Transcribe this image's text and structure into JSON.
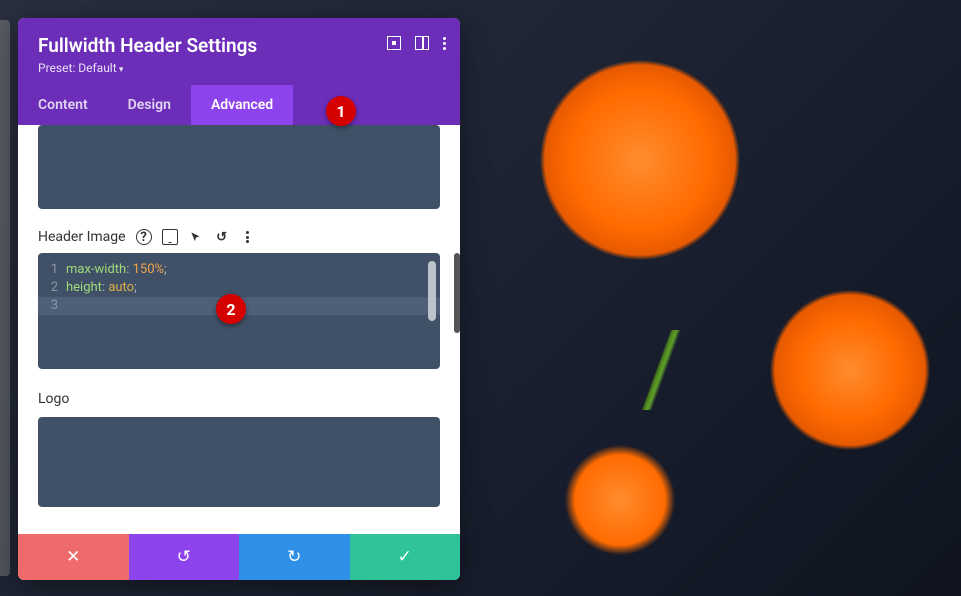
{
  "panel": {
    "title": "Fullwidth Header Settings",
    "preset": "Preset: Default"
  },
  "tabs": {
    "content": "Content",
    "design": "Design",
    "advanced": "Advanced"
  },
  "sections": {
    "header_image_label": "Header Image",
    "logo_label": "Logo"
  },
  "editor": {
    "lines": [
      {
        "n": "1",
        "prop": "max-width",
        "val": "150%"
      },
      {
        "n": "2",
        "prop": "height",
        "val": "auto"
      },
      {
        "n": "3",
        "prop": "",
        "val": ""
      }
    ]
  },
  "callouts": {
    "c1": "1",
    "c2": "2"
  },
  "icons": {
    "expand": "expand-icon",
    "columns": "columns-icon",
    "more": "more-icon",
    "help": "?",
    "undo_glyph": "↺",
    "close_glyph": "✕",
    "undo2_glyph": "↺",
    "redo_glyph": "↻",
    "check_glyph": "✓"
  }
}
